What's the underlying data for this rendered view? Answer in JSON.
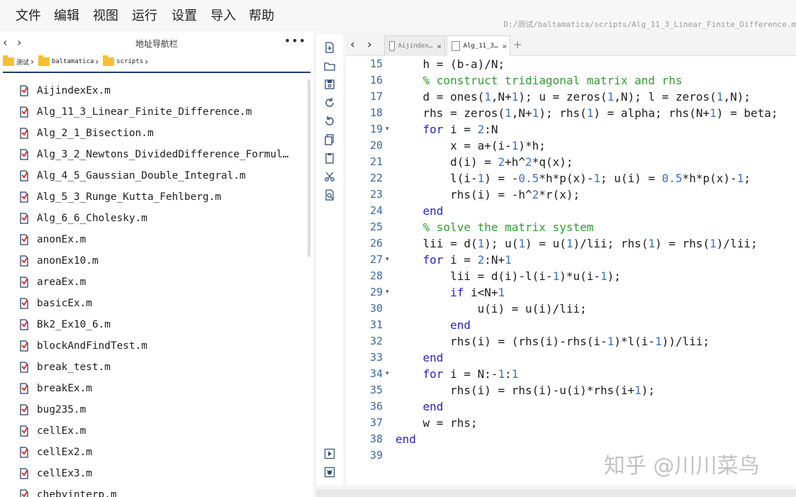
{
  "menu": [
    "文件",
    "编辑",
    "视图",
    "运行",
    "设置",
    "导入",
    "帮助"
  ],
  "window_path": "D:/测试/baltamatica/scripts/Alg_11_3_Linear_Finite_Difference.m",
  "navigator": {
    "title": "地址导航栏",
    "more": "•••",
    "back_icon": "‹",
    "forward_icon": "›",
    "breadcrumbs": [
      "测试",
      "baltamatica",
      "scripts"
    ],
    "files": [
      "AijindexEx.m",
      "Alg_11_3_Linear_Finite_Difference.m",
      "Alg_2_1_Bisection.m",
      "Alg_3_2_Newtons_DividedDifference_Formul…",
      "Alg_4_5_Gaussian_Double_Integral.m",
      "Alg_5_3_Runge_Kutta_Fehlberg.m",
      "Alg_6_6_Cholesky.m",
      "anonEx.m",
      "anonEx10.m",
      "areaEx.m",
      "basicEx.m",
      "Bk2_Ex10_6.m",
      "blockAndFindTest.m",
      "break_test.m",
      "breakEx.m",
      "bug235.m",
      "cellEx.m",
      "cellEx2.m",
      "cellEx3.m",
      "chebyinterp.m"
    ]
  },
  "editor": {
    "tabs": [
      {
        "label": "Aijindex…",
        "active": false
      },
      {
        "label": "Alg_11_3…",
        "active": true
      }
    ],
    "tab_close": "×",
    "tab_add": "+",
    "lines": [
      {
        "n": "15",
        "fold": "",
        "code": [
          [
            "    h = (b-a)/N;",
            ""
          ]
        ]
      },
      {
        "n": "16",
        "fold": "",
        "code": [
          [
            "    ",
            ""
          ],
          [
            "% construct tridiagonal matrix and rhs",
            "c"
          ]
        ]
      },
      {
        "n": "17",
        "fold": "",
        "code": [
          [
            "    d = ones(",
            ""
          ],
          [
            "1",
            "n"
          ],
          [
            ",N+",
            ""
          ],
          [
            "1",
            "n"
          ],
          [
            "); u = zeros(",
            ""
          ],
          [
            "1",
            "n"
          ],
          [
            ",N); l = zeros(",
            ""
          ],
          [
            "1",
            "n"
          ],
          [
            ",N);",
            ""
          ]
        ]
      },
      {
        "n": "18",
        "fold": "",
        "code": [
          [
            "    rhs = zeros(",
            ""
          ],
          [
            "1",
            "n"
          ],
          [
            ",N+",
            ""
          ],
          [
            "1",
            "n"
          ],
          [
            "); rhs(",
            ""
          ],
          [
            "1",
            "n"
          ],
          [
            ") = alpha; rhs(N+",
            ""
          ],
          [
            "1",
            "n"
          ],
          [
            ") = beta;",
            ""
          ]
        ]
      },
      {
        "n": "19",
        "fold": "▾",
        "code": [
          [
            "    ",
            ""
          ],
          [
            "for",
            "k"
          ],
          [
            " i = ",
            ""
          ],
          [
            "2",
            "n"
          ],
          [
            ":N",
            ""
          ]
        ]
      },
      {
        "n": "20",
        "fold": "",
        "code": [
          [
            "        x = a+(i-",
            ""
          ],
          [
            "1",
            "n"
          ],
          [
            ")*h;",
            ""
          ]
        ]
      },
      {
        "n": "21",
        "fold": "",
        "code": [
          [
            "        d(i) = ",
            ""
          ],
          [
            "2",
            "n"
          ],
          [
            "+h^",
            ""
          ],
          [
            "2",
            "n"
          ],
          [
            "*q(x);",
            ""
          ]
        ]
      },
      {
        "n": "22",
        "fold": "",
        "code": [
          [
            "        l(i-",
            ""
          ],
          [
            "1",
            "n"
          ],
          [
            ") = -",
            ""
          ],
          [
            "0.5",
            "n"
          ],
          [
            "*h*p(x)-",
            ""
          ],
          [
            "1",
            "n"
          ],
          [
            "; u(i) = ",
            ""
          ],
          [
            "0.5",
            "n"
          ],
          [
            "*h*p(x)-",
            ""
          ],
          [
            "1",
            "n"
          ],
          [
            ";",
            ""
          ]
        ]
      },
      {
        "n": "23",
        "fold": "",
        "code": [
          [
            "        rhs(i) = -h^",
            ""
          ],
          [
            "2",
            "n"
          ],
          [
            "*r(x);",
            ""
          ]
        ]
      },
      {
        "n": "24",
        "fold": "",
        "code": [
          [
            "    ",
            ""
          ],
          [
            "end",
            "k"
          ]
        ]
      },
      {
        "n": "25",
        "fold": "",
        "code": [
          [
            "    ",
            ""
          ],
          [
            "% solve the matrix system",
            "c"
          ]
        ]
      },
      {
        "n": "26",
        "fold": "",
        "code": [
          [
            "    lii = d(",
            ""
          ],
          [
            "1",
            "n"
          ],
          [
            "); u(",
            ""
          ],
          [
            "1",
            "n"
          ],
          [
            ") = u(",
            ""
          ],
          [
            "1",
            "n"
          ],
          [
            ")/lii; rhs(",
            ""
          ],
          [
            "1",
            "n"
          ],
          [
            ") = rhs(",
            ""
          ],
          [
            "1",
            "n"
          ],
          [
            ")/lii;",
            ""
          ]
        ]
      },
      {
        "n": "27",
        "fold": "▾",
        "code": [
          [
            "    ",
            ""
          ],
          [
            "for",
            "k"
          ],
          [
            " i = ",
            ""
          ],
          [
            "2",
            "n"
          ],
          [
            ":N+",
            ""
          ],
          [
            "1",
            "n"
          ]
        ]
      },
      {
        "n": "28",
        "fold": "",
        "code": [
          [
            "        lii = d(i)-l(i-",
            ""
          ],
          [
            "1",
            "n"
          ],
          [
            ")*u(i-",
            ""
          ],
          [
            "1",
            "n"
          ],
          [
            ");",
            ""
          ]
        ]
      },
      {
        "n": "29",
        "fold": "▾",
        "code": [
          [
            "        ",
            ""
          ],
          [
            "if",
            "k"
          ],
          [
            " i<N+",
            ""
          ],
          [
            "1",
            "n"
          ]
        ]
      },
      {
        "n": "30",
        "fold": "",
        "code": [
          [
            "            u(i) = u(i)/lii;",
            ""
          ]
        ]
      },
      {
        "n": "31",
        "fold": "",
        "code": [
          [
            "        ",
            ""
          ],
          [
            "end",
            "k"
          ]
        ]
      },
      {
        "n": "32",
        "fold": "",
        "code": [
          [
            "        rhs(i) = (rhs(i)-rhs(i-",
            ""
          ],
          [
            "1",
            "n"
          ],
          [
            ")*l(i-",
            ""
          ],
          [
            "1",
            "n"
          ],
          [
            "))/lii;",
            ""
          ]
        ]
      },
      {
        "n": "33",
        "fold": "",
        "code": [
          [
            "    ",
            ""
          ],
          [
            "end",
            "k"
          ]
        ]
      },
      {
        "n": "34",
        "fold": "▾",
        "code": [
          [
            "    ",
            ""
          ],
          [
            "for",
            "k"
          ],
          [
            " i = N:-",
            ""
          ],
          [
            "1",
            "n"
          ],
          [
            ":",
            ""
          ],
          [
            "1",
            "n"
          ]
        ]
      },
      {
        "n": "35",
        "fold": "",
        "code": [
          [
            "        rhs(i) = rhs(i)-u(i)*rhs(i+",
            ""
          ],
          [
            "1",
            "n"
          ],
          [
            ");",
            ""
          ]
        ]
      },
      {
        "n": "36",
        "fold": "",
        "code": [
          [
            "    ",
            ""
          ],
          [
            "end",
            "k"
          ]
        ]
      },
      {
        "n": "37",
        "fold": "",
        "code": [
          [
            "    w = rhs;",
            ""
          ]
        ]
      },
      {
        "n": "38",
        "fold": "",
        "code": [
          [
            "",
            ""
          ],
          [
            "end",
            "k"
          ]
        ]
      },
      {
        "n": "39",
        "fold": "",
        "code": [
          [
            "",
            ""
          ]
        ]
      }
    ]
  },
  "toolbar_icons": [
    "new-file-icon",
    "open-folder-icon",
    "save-icon",
    "redo-icon",
    "undo-icon",
    "copy-icon",
    "paste-icon",
    "cut-icon",
    "find-icon",
    "run-icon",
    "debug-icon"
  ],
  "watermark": "知乎 @川川菜鸟",
  "colors": {
    "keyword": "#2424c8",
    "comment": "#2f9e2f",
    "number": "#3b6fd4",
    "line_number": "#3a6aa0",
    "nav_underline": "#1f3c6e",
    "folder": "#f5c033"
  }
}
